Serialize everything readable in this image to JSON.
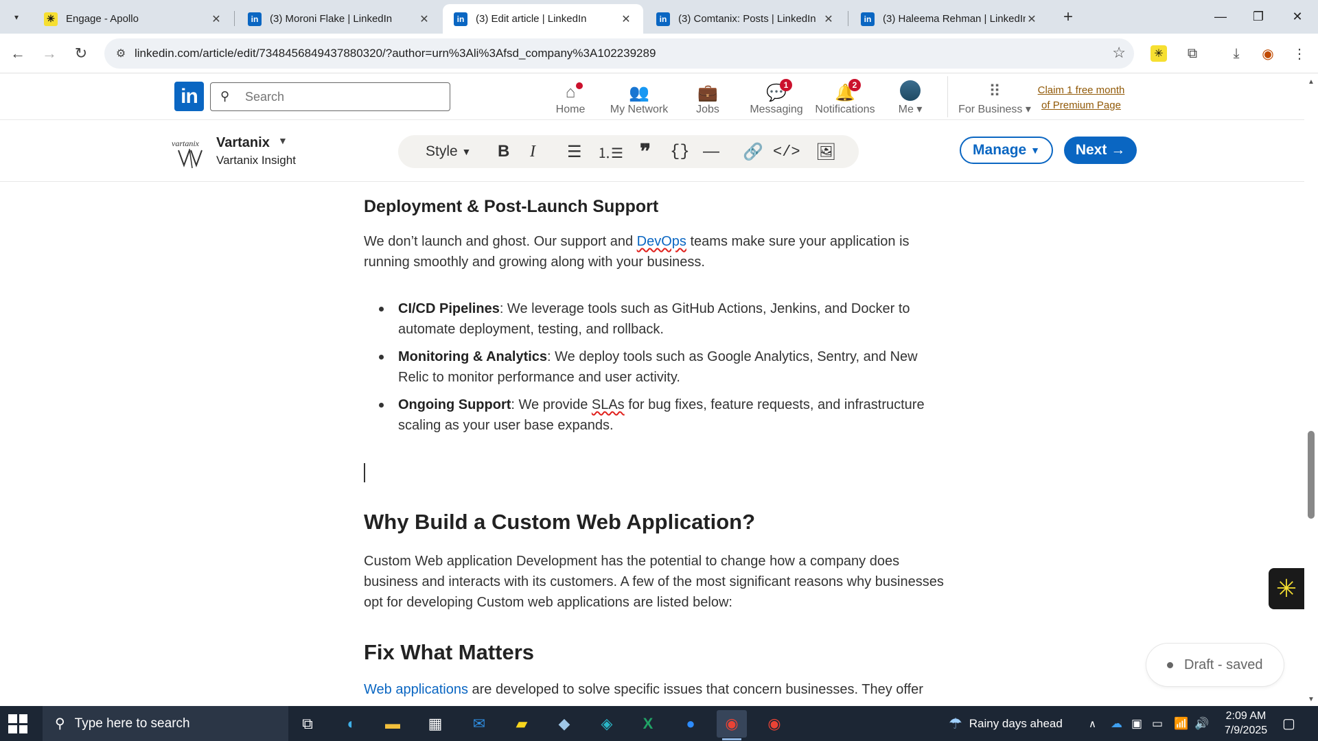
{
  "browser": {
    "tabs": [
      {
        "title": "Engage - Apollo",
        "favicon": "apollo-icon"
      },
      {
        "title": "(3) Moroni Flake | LinkedIn",
        "favicon": "linkedin-icon"
      },
      {
        "title": "(3) Edit article | LinkedIn",
        "favicon": "linkedin-icon",
        "active": true
      },
      {
        "title": "(3) Comtanix: Posts | LinkedIn",
        "favicon": "linkedin-icon"
      },
      {
        "title": "(3) Haleema Rehman | LinkedIn",
        "favicon": "linkedin-icon"
      }
    ],
    "url": "linkedin.com/article/edit/7348456849437880320/?author=urn%3Ali%3Afsd_company%3A102239289"
  },
  "linkedin": {
    "logo": "in",
    "search_placeholder": "Search",
    "nav": [
      {
        "label": "Home",
        "icon": "home-icon"
      },
      {
        "label": "My Network",
        "icon": "network-icon"
      },
      {
        "label": "Jobs",
        "icon": "briefcase-icon"
      },
      {
        "label": "Messaging",
        "icon": "message-icon",
        "badge": "1"
      },
      {
        "label": "Notifications",
        "icon": "bell-icon",
        "badge": "2"
      },
      {
        "label": "Me",
        "icon": "avatar"
      },
      {
        "label": "For Business",
        "icon": "grid-icon"
      }
    ],
    "premium_line1": "Claim 1 free month",
    "premium_line2": "of Premium Page"
  },
  "editor": {
    "author_name": "Vartanix",
    "author_sub": "Vartanix Insight",
    "style_label": "Style",
    "manage_label": "Manage",
    "next_label": "Next",
    "draft_status": "Draft - saved"
  },
  "article": {
    "h_deploy": "Deployment & Post-Launch Support",
    "p_deploy_1": "We don’t launch and ghost. Our support and ",
    "p_deploy_link": "DevOps",
    "p_deploy_2": " teams make sure your application is running smoothly and growing along with your business.",
    "bullets": [
      {
        "term": "CI/CD Pipelines",
        "text": ": We leverage tools such as GitHub Actions, Jenkins, and Docker to automate deployment, testing, and rollback."
      },
      {
        "term": "Monitoring & Analytics",
        "text": ": We deploy tools such as Google Analytics, Sentry, and New Relic to monitor performance and user activity."
      },
      {
        "term": "Ongoing Support",
        "text_1": ": We provide ",
        "squig": "SLAs",
        "text_2": " for bug fixes, feature requests, and infrastructure scaling as your user base expands."
      }
    ],
    "h_why": "Why Build a Custom Web Application?",
    "p_why": "Custom Web application Development has the potential to change how a company does business and interacts with its customers. A few of the most significant reasons why businesses opt for developing Custom web applications are listed below:",
    "h_fix": "Fix What Matters",
    "p_fix_link": "Web applications",
    "p_fix_text": " are developed to solve specific issues that concern businesses. They offer"
  },
  "taskbar": {
    "search_placeholder": "Type here to search",
    "weather": "Rainy days ahead",
    "time": "2:09 AM",
    "date": "7/9/2025"
  },
  "colors": {
    "linkedin_blue": "#0a66c2",
    "badge_red": "#cb112d",
    "premium_gold": "#915907"
  }
}
